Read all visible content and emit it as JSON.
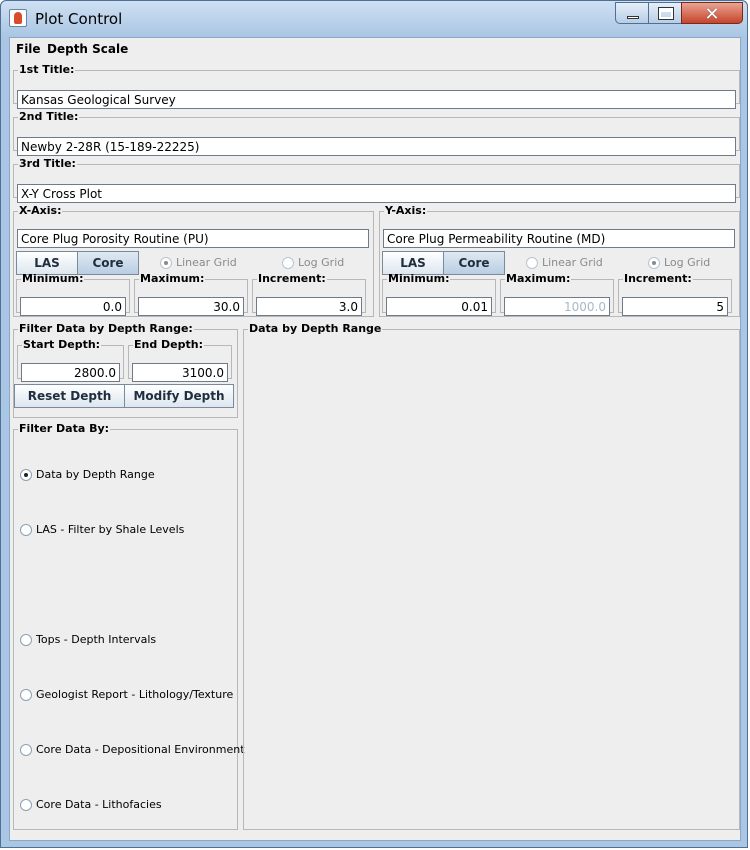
{
  "window": {
    "title": "Plot Control"
  },
  "menu": {
    "file": "File",
    "depth_scale": "Depth Scale"
  },
  "titles": {
    "first_label": "1st Title:",
    "first_value": "Kansas Geological Survey",
    "second_label": "2nd Title:",
    "second_value": "Newby 2-28R (15-189-22225)",
    "third_label": "3rd Title:",
    "third_value": "X-Y Cross Plot"
  },
  "x_axis": {
    "label": "X-Axis:",
    "variable": "Core Plug Porosity Routine (PU)",
    "las_button": "LAS",
    "core_button": "Core",
    "linear_grid": "Linear Grid",
    "log_grid": "Log Grid",
    "selected_grid": "linear",
    "minimum_label": "Minimum:",
    "minimum": "0.0",
    "maximum_label": "Maximum:",
    "maximum": "30.0",
    "increment_label": "Increment:",
    "increment": "3.0"
  },
  "y_axis": {
    "label": "Y-Axis:",
    "variable": "Core Plug Permeability Routine (MD)",
    "las_button": "LAS",
    "core_button": "Core",
    "linear_grid": "Linear Grid",
    "log_grid": "Log Grid",
    "selected_grid": "log",
    "minimum_label": "Minimum:",
    "minimum": "0.01",
    "maximum_label": "Maximum:",
    "maximum": "1000.0",
    "increment_label": "Increment:",
    "increment": "5"
  },
  "depth_filter": {
    "label": "Filter Data by Depth Range:",
    "start_label": "Start Depth:",
    "start_value": "2800.0",
    "end_label": "End Depth:",
    "end_value": "3100.0",
    "reset_button": "Reset Depth",
    "modify_button": "Modify Depth"
  },
  "filter_by": {
    "label": "Filter Data By:",
    "options": [
      {
        "label": "Data by Depth Range",
        "selected": true
      },
      {
        "label": "LAS - Filter by Shale Levels",
        "selected": false
      },
      {
        "label": "Tops - Depth Intervals",
        "selected": false
      },
      {
        "label": "Geologist Report - Lithology/Texture",
        "selected": false
      },
      {
        "label": "Core Data - Depositional Environment",
        "selected": false
      },
      {
        "label": "Core Data - Lithofacies",
        "selected": false
      }
    ]
  },
  "data_panel": {
    "label": "Data by Depth Range"
  }
}
